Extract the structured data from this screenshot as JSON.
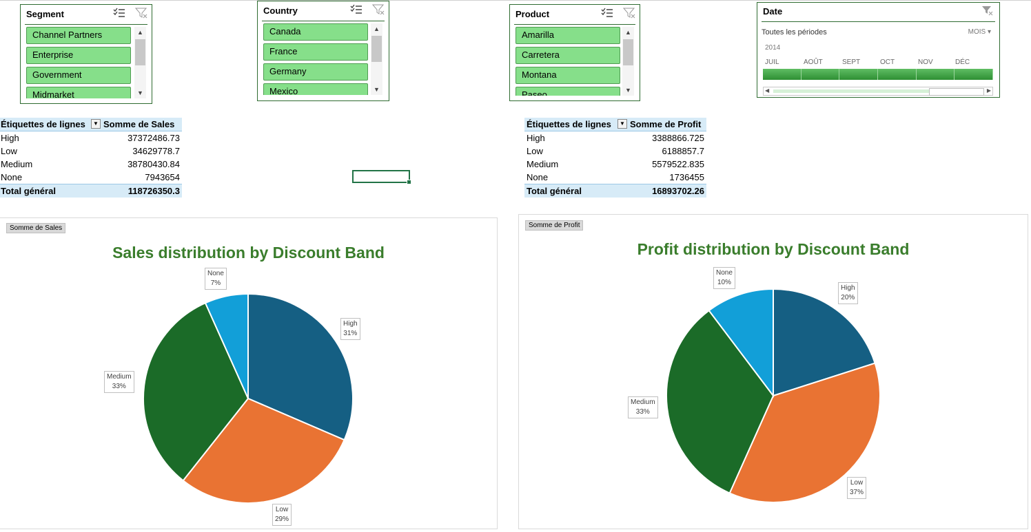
{
  "slicers": {
    "segment": {
      "title": "Segment",
      "items": [
        "Channel Partners",
        "Enterprise",
        "Government",
        "Midmarket"
      ]
    },
    "country": {
      "title": "Country",
      "items": [
        "Canada",
        "France",
        "Germany",
        "Mexico"
      ]
    },
    "product": {
      "title": "Product",
      "items": [
        "Amarilla",
        "Carretera",
        "Montana",
        "Paseo"
      ]
    }
  },
  "timeline": {
    "title": "Date",
    "period_label": "Toutes les périodes",
    "level_label": "MOIS",
    "year": "2014",
    "months": [
      "JUIL",
      "AOÛT",
      "SEPT",
      "OCT",
      "NOV",
      "DÉC"
    ]
  },
  "pivot_sales": {
    "row_header": "Étiquettes de lignes",
    "value_header": "Somme de  Sales",
    "rows": [
      {
        "label": "High",
        "value": "37372486.73"
      },
      {
        "label": "Low",
        "value": "34629778.7"
      },
      {
        "label": "Medium",
        "value": "38780430.84"
      },
      {
        "label": "None",
        "value": "7943654"
      }
    ],
    "total_label": "Total général",
    "total_value": "118726350.3"
  },
  "pivot_profit": {
    "row_header": "Étiquettes de lignes",
    "value_header": "Somme de Profit",
    "rows": [
      {
        "label": "High",
        "value": "3388866.725"
      },
      {
        "label": "Low",
        "value": "6188857.7"
      },
      {
        "label": "Medium",
        "value": "5579522.835"
      },
      {
        "label": "None",
        "value": "1736455"
      }
    ],
    "total_label": "Total général",
    "total_value": "16893702.26"
  },
  "charts": {
    "sales": {
      "field_button": "Somme  de  Sales"
    },
    "profit": {
      "field_button": "Somme  de Profit"
    }
  },
  "chart_data": [
    {
      "type": "pie",
      "title": "Sales distribution by Discount Band",
      "categories": [
        "High",
        "Low",
        "Medium",
        "None"
      ],
      "values": [
        37372486.73,
        34629778.7,
        38780430.84,
        7943654
      ],
      "percent_labels": [
        "31%",
        "29%",
        "33%",
        "7%"
      ],
      "colors": [
        "#155f83",
        "#e97333",
        "#1b6b28",
        "#129fd8"
      ]
    },
    {
      "type": "pie",
      "title": "Profit distribution by Discount Band",
      "categories": [
        "High",
        "Low",
        "Medium",
        "None"
      ],
      "values": [
        3388866.725,
        6188857.7,
        5579522.835,
        1736455
      ],
      "percent_labels": [
        "20%",
        "37%",
        "33%",
        "10%"
      ],
      "colors": [
        "#155f83",
        "#e97333",
        "#1b6b28",
        "#129fd8"
      ]
    }
  ]
}
